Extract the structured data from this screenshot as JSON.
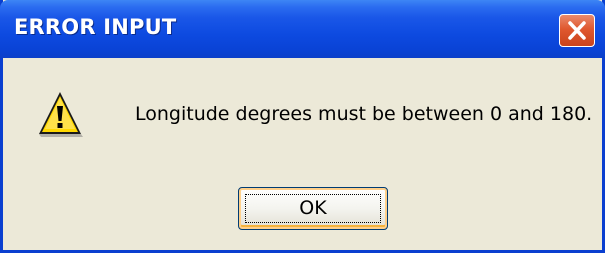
{
  "dialog": {
    "title": "ERROR INPUT",
    "message": "Longitude degrees must be between 0 and 180.",
    "ok_label": "OK",
    "icon": "warning-icon",
    "close_icon": "close-icon"
  },
  "colors": {
    "titlebar": "#0a43d6",
    "frame": "#0a3fd0",
    "body": "#ece9d8",
    "close_button": "#e0582f",
    "warning_fill": "#ffd800"
  }
}
